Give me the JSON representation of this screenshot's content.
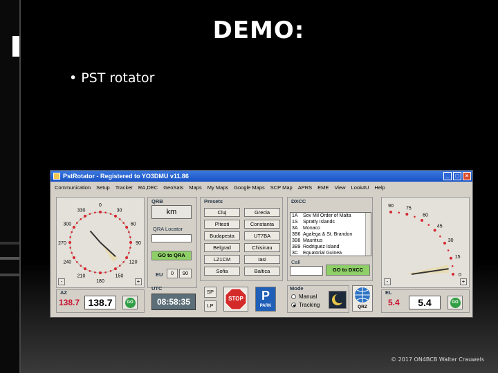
{
  "slide": {
    "title": "DEMO:",
    "bullet": "PST rotator",
    "footer": "© 2017 ON4BCB Walter Crauwels"
  },
  "window": {
    "title": "PstRotator - Registered to YO3DMU   v11.86",
    "menu": [
      "Communication",
      "Setup",
      "Tracker",
      "RA,DEC",
      "GeoSats",
      "Maps",
      "My Maps",
      "Google Maps",
      "SCP Map",
      "APRS",
      "EME",
      "View",
      "Look4U",
      "Help"
    ]
  },
  "az": {
    "label": "AZ",
    "ticks": [
      "0",
      "30",
      "60",
      "90",
      "120",
      "150",
      "180",
      "210",
      "240",
      "270",
      "300",
      "330"
    ],
    "target": "138.7",
    "current": "138.7",
    "go_label": "GO",
    "minus": "-",
    "plus": "+"
  },
  "qrb": {
    "label": "QRB",
    "unit": "km",
    "locator_label": "QRA Locator",
    "goto_label": "GO to QRA",
    "eu_label": "EU",
    "eu_0": "0",
    "eu_90": "90"
  },
  "utc": {
    "label": "UTC",
    "time": "08:58:35"
  },
  "presets": {
    "label": "Presets",
    "items": [
      "Cluj",
      "Grecia",
      "Pltesti",
      "Constanta",
      "Budapesta",
      "UT7BA",
      "Belgrad",
      "Chisinau",
      "LZ1CM",
      "Iasi",
      "Sofia",
      "Baltica"
    ]
  },
  "actions": {
    "sp": "SP",
    "lp": "LP",
    "stop": "STOP",
    "park": "PARK",
    "qrz": "QRZ"
  },
  "mode": {
    "label": "Mode",
    "manual": "Manual",
    "tracking": "Tracking",
    "selected": "Tracking"
  },
  "dxcc": {
    "label": "DXCC",
    "rows": [
      [
        "1A",
        "Sov Mil Order of Malta"
      ],
      [
        "1S",
        "Spratly Islands"
      ],
      [
        "3A",
        "Monaco"
      ],
      [
        "3B6",
        "Agalega & St. Brandon"
      ],
      [
        "3B8",
        "Mauritius"
      ],
      [
        "3B9",
        "Rodriguez Island"
      ],
      [
        "3C",
        "Equatorial Guinea"
      ]
    ],
    "call_label": "Call",
    "goto_label": "GO to DXCC"
  },
  "el": {
    "label": "EL",
    "ticks": [
      "90",
      "75",
      "60",
      "45",
      "30",
      "15",
      "0"
    ],
    "target": "5.4",
    "current": "5.4",
    "go_label": "GO",
    "minus": "-",
    "plus": "+"
  },
  "colors": {
    "accent_red": "#c8102e",
    "go_green": "#2f9e44",
    "titlebar_blue": "#1a52c4",
    "window_gray": "#d4d0c8",
    "utc_bg": "#5c6e78"
  }
}
